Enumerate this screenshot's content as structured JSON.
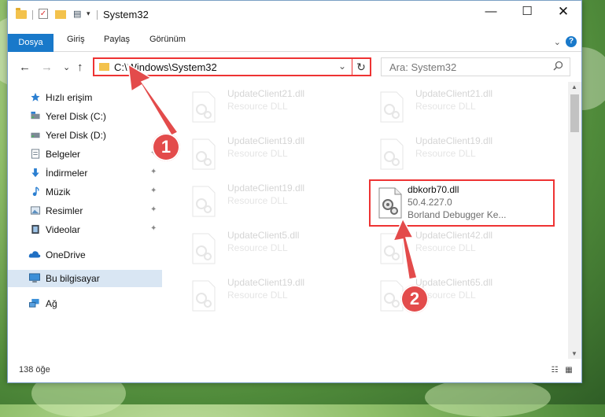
{
  "window": {
    "title": "System32",
    "controls": {
      "minimize": "—",
      "maximize": "☐",
      "close": "✕"
    }
  },
  "ribbon": {
    "tabs": [
      "Dosya",
      "Giriş",
      "Paylaş",
      "Görünüm"
    ],
    "expand_glyph": "⌄",
    "help_glyph": "?"
  },
  "nav": {
    "back": "←",
    "forward": "→",
    "recent": "⌄",
    "up": "↑"
  },
  "address": {
    "path": "C:\\Windows\\System32",
    "dropdown_glyph": "⌄",
    "refresh_glyph": "↻"
  },
  "search": {
    "placeholder": "Ara: System32",
    "icon": "search-icon"
  },
  "sidebar": {
    "items": [
      {
        "label": "Hızlı erişim",
        "icon": "star-icon",
        "pinned": false
      },
      {
        "label": "Yerel Disk (C:)",
        "icon": "drive-icon",
        "pinned": true
      },
      {
        "label": "Yerel Disk (D:)",
        "icon": "drive-icon",
        "pinned": true
      },
      {
        "label": "Belgeler",
        "icon": "documents-icon",
        "pinned": true
      },
      {
        "label": "İndirmeler",
        "icon": "download-icon",
        "pinned": true
      },
      {
        "label": "Müzik",
        "icon": "music-icon",
        "pinned": true
      },
      {
        "label": "Resimler",
        "icon": "pictures-icon",
        "pinned": true
      },
      {
        "label": "Videolar",
        "icon": "video-icon",
        "pinned": true
      },
      {
        "label": "OneDrive",
        "icon": "cloud-icon",
        "pinned": false
      },
      {
        "label": "Bu bilgisayar",
        "icon": "computer-icon",
        "pinned": false
      },
      {
        "label": "Ağ",
        "icon": "network-icon",
        "pinned": false
      }
    ],
    "pin_glyph": "📌"
  },
  "files": {
    "left_column": [
      {
        "name": "UpdateClient21.dll",
        "type": "Resource DLL"
      },
      {
        "name": "UpdateClient19.dll",
        "type": "Resource DLL"
      },
      {
        "name": "UpdateClient19.dll",
        "type": "Resource DLL"
      },
      {
        "name": "UpdateClient5.dll",
        "type": "Resource DLL"
      },
      {
        "name": "UpdateClient19.dll",
        "type": "Resource DLL"
      }
    ],
    "right_column": [
      {
        "name": "UpdateClient21.dll",
        "type": "Resource DLL"
      },
      {
        "name": "UpdateClient19.dll",
        "type": "Resource DLL"
      },
      {
        "name": "dbkorb70.dll",
        "version": "50.4.227.0",
        "description": "Borland Debugger Ke...",
        "highlighted": true
      },
      {
        "name": "UpdateClient42.dll",
        "type": "Resource DLL"
      },
      {
        "name": "UpdateClient65.dll",
        "type": "Resource DLL"
      }
    ]
  },
  "status": {
    "item_count": "138 öğe"
  },
  "callouts": [
    "1",
    "2"
  ],
  "colors": {
    "accent": "#1979ca",
    "highlight": "#e33333",
    "callout": "#e34b4b",
    "selected_nav": "#d9e6f3"
  }
}
